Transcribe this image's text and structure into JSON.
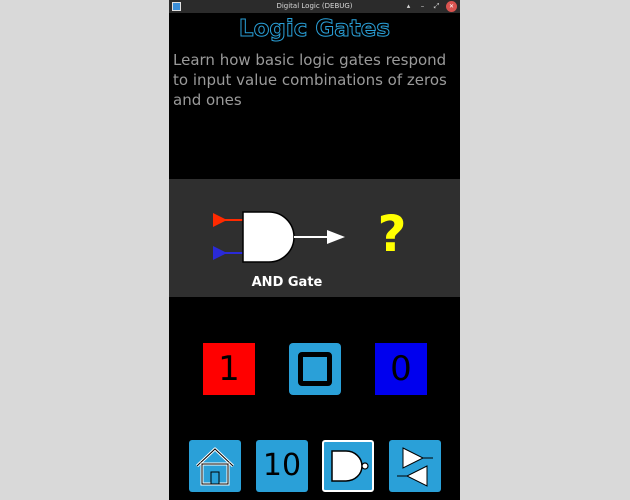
{
  "window": {
    "title": "Digital Logic (DEBUG)",
    "controls": [
      "▴",
      "–",
      "⤢",
      "✕"
    ]
  },
  "heading": "Logic Gates",
  "description": "Learn how basic logic gates respond to input value combinations of zeros and ones",
  "gate": {
    "name": "AND Gate",
    "output": "?",
    "icons": [
      "red-input-arrow",
      "blue-input-arrow",
      "and-gate",
      "output-arrow"
    ]
  },
  "inputs": {
    "one_label": "1",
    "zero_label": "0",
    "one_color": "#ff0000",
    "zero_color": "#0000ee",
    "accent": "#2aa0d8"
  },
  "nav": {
    "binary_label": "10",
    "icons": [
      "home-icon",
      "nand-gate-icon",
      "buffer-gates-icon"
    ]
  }
}
